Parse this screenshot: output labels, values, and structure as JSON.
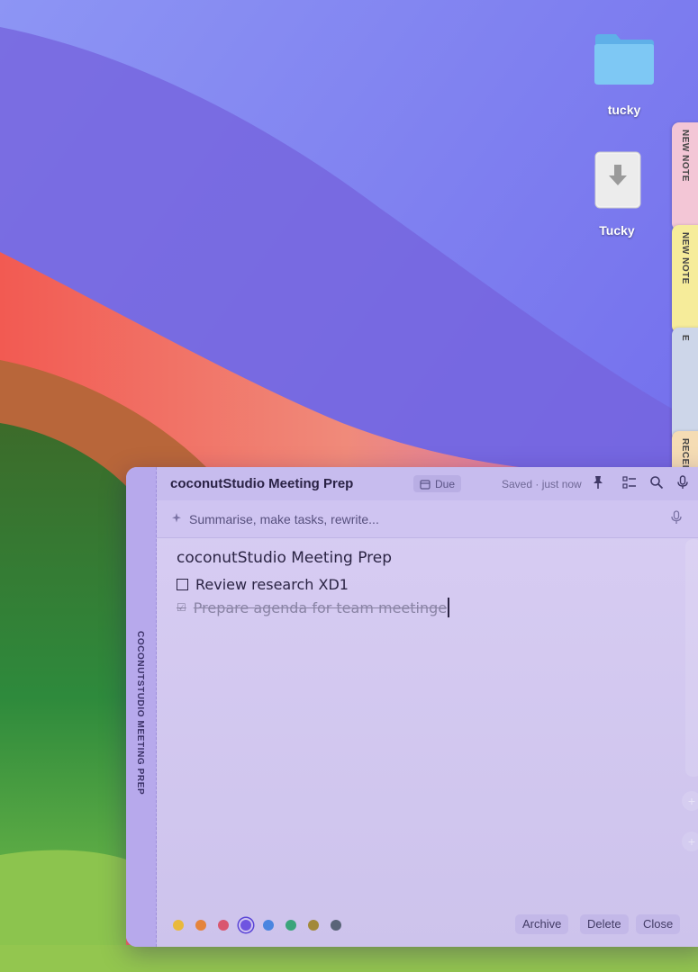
{
  "desktop": {
    "icons": [
      {
        "label": "tucky",
        "icon": "folder-icon"
      },
      {
        "label": "Tucky",
        "icon": "external-drive-icon"
      }
    ]
  },
  "side_tabs": [
    {
      "label": "NEW NOTE",
      "color": "#f3c6d6"
    },
    {
      "label": "NEW NOTE",
      "color": "#f6ec9a"
    },
    {
      "label": "E",
      "color": "#cdd6e9"
    },
    {
      "label": "RECEI",
      "color": "#f5dcb4"
    }
  ],
  "note": {
    "spine_label": "COCONUTSTUDIO MEETING PREP",
    "title": "coconutStudio Meeting Prep",
    "due_label": "Due",
    "saved_status": "Saved · just now",
    "toolbar_icons": [
      "pin-icon",
      "checklist-icon",
      "search-icon",
      "microphone-icon",
      "sparkle-icon"
    ],
    "ai_placeholder": "Summarise, make tasks, rewrite...",
    "body": {
      "heading": "coconutStudio Meeting Prep",
      "tasks": [
        {
          "text": "Review research XD1",
          "done": false
        },
        {
          "text": "Prepare agenda for team meetinge",
          "done": true
        }
      ]
    },
    "color_swatches": [
      "#e9b93c",
      "#e5843c",
      "#d9566f",
      "#6f55e0",
      "#4a85e0",
      "#3aa47a",
      "#a2893a",
      "#5a6478"
    ],
    "selected_swatch": 3,
    "buttons": {
      "archive": "Archive",
      "delete": "Delete",
      "close": "Close"
    }
  }
}
